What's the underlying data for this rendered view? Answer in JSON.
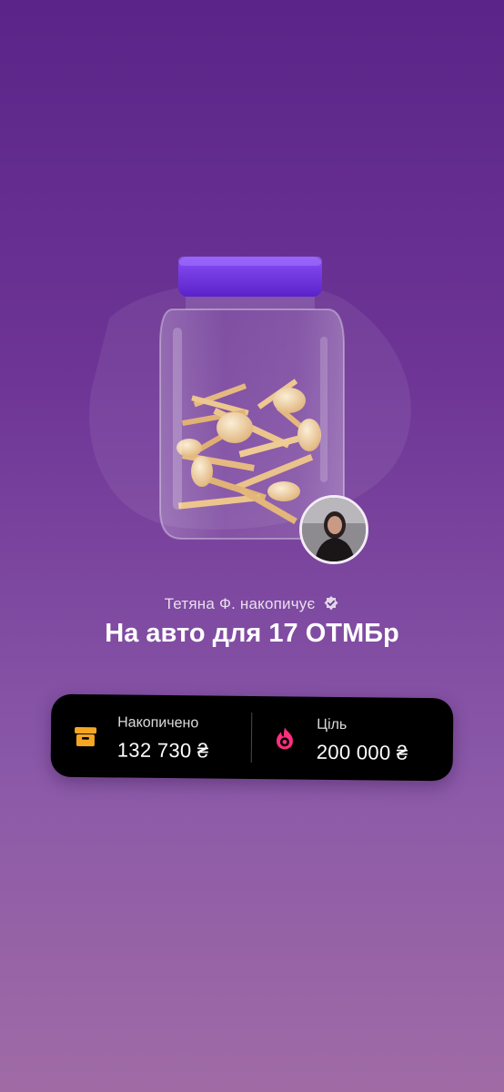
{
  "owner_line": "Тетяна Ф. накопичує",
  "jar_title": "На авто для 17 ОТМБр",
  "stats": {
    "saved": {
      "label": "Накопичено",
      "value": "132 730 ₴",
      "icon": "archive-box-icon",
      "icon_color": "#f5a623"
    },
    "goal": {
      "label": "Ціль",
      "value": "200 000 ₴",
      "icon": "flame-target-icon",
      "icon_color": "#ff2e7e"
    }
  },
  "progress": 0.6637,
  "colors": {
    "background_top": "#5a2488",
    "background_bottom": "#a06ba5",
    "jar_lid": "#7b3ff2",
    "card": "#000000"
  }
}
